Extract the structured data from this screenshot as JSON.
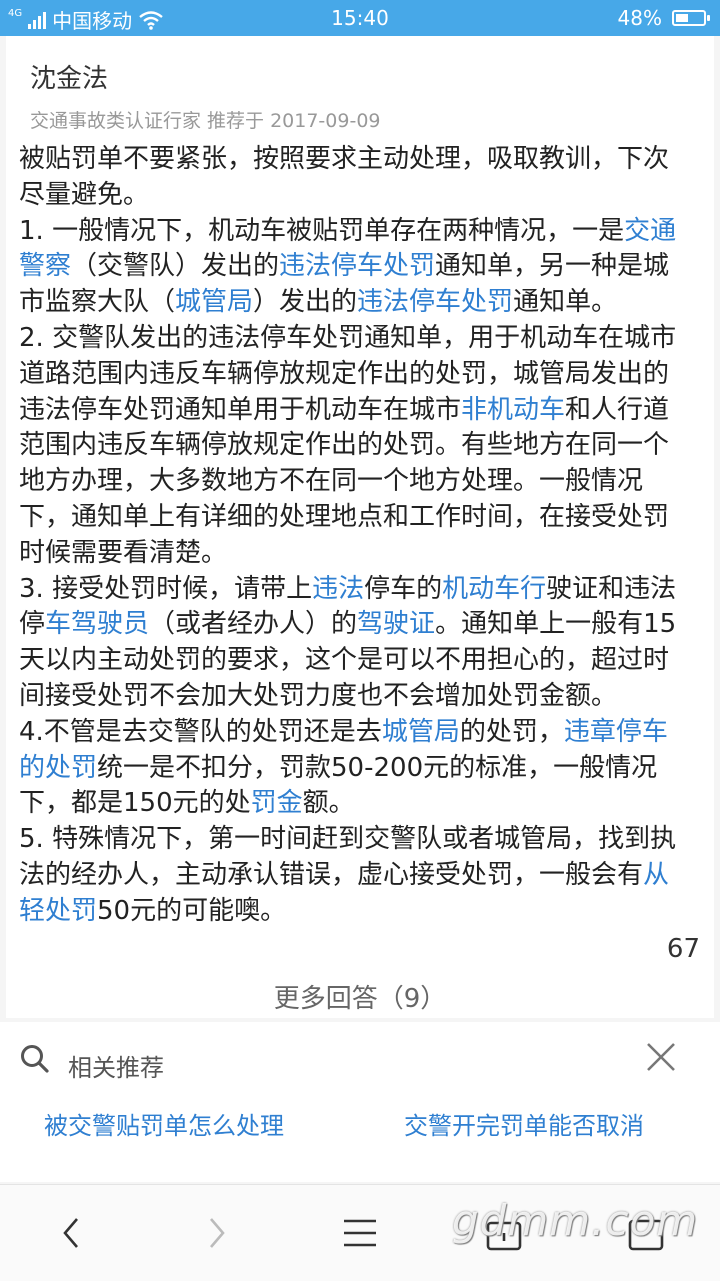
{
  "status": {
    "network_label": "4G",
    "carrier": "中国移动",
    "time": "15:40",
    "battery": "48%",
    "battery_level": 0.48
  },
  "answer": {
    "author": "沈金法",
    "meta": "交通事故类认证行家 推荐于 2017-09-09",
    "likes": "67",
    "paragraphs": [
      [
        {
          "t": "被贴罚单不要紧张，按照要求主动处理，吸取教训，下次尽量避免。",
          "link": false
        }
      ],
      [
        {
          "t": "1. 一般情况下，机动车被贴罚单存在两种情况，一是",
          "link": false
        },
        {
          "t": "交通警察",
          "link": true
        },
        {
          "t": "（交警队）发出的",
          "link": false
        },
        {
          "t": "违法停车处罚",
          "link": true
        },
        {
          "t": "通知单，另一种是城市监察大队（",
          "link": false
        },
        {
          "t": "城管局",
          "link": true
        },
        {
          "t": "）发出的",
          "link": false
        },
        {
          "t": "违法停车处罚",
          "link": true
        },
        {
          "t": "通知单。",
          "link": false
        }
      ],
      [
        {
          "t": "2. 交警队发出的违法停车处罚通知单，用于机动车在城市道路范围内违反车辆停放规定作出的处罚，城管局发出的违法停车处罚通知单用于机动车在城市",
          "link": false
        },
        {
          "t": "非机动车",
          "link": true
        },
        {
          "t": "和人行道范围内违反车辆停放规定作出的处罚。有些地方在同一个地方办理，大多数地方不在同一个地方处理。一般情况下，通知单上有详细的处理地点和工作时间，在接受处罚时候需要看清楚。",
          "link": false
        }
      ],
      [
        {
          "t": "3. 接受处罚时候，请带上",
          "link": false
        },
        {
          "t": "违法",
          "link": true
        },
        {
          "t": "停车的",
          "link": false
        },
        {
          "t": "机动车行",
          "link": true
        },
        {
          "t": "驶证和违法停",
          "link": false
        },
        {
          "t": "车驾驶员",
          "link": true
        },
        {
          "t": "（或者经办人）的",
          "link": false
        },
        {
          "t": "驾驶证",
          "link": true
        },
        {
          "t": "。通知单上一般有15天以内主动处罚的要求，这个是可以不用担心的，超过时间接受处罚不会加大处罚力度也不会增加处罚金额。",
          "link": false
        }
      ],
      [
        {
          "t": "4.不管是去交警队的处罚还是去",
          "link": false
        },
        {
          "t": "城管局",
          "link": true
        },
        {
          "t": "的处罚，",
          "link": false
        },
        {
          "t": "违章停车的处罚",
          "link": true
        },
        {
          "t": "统一是不扣分，罚款50-200元的标准，一般情况下，都是150元的处",
          "link": false
        },
        {
          "t": "罚金",
          "link": true
        },
        {
          "t": "额。",
          "link": false
        }
      ],
      [
        {
          "t": "5. 特殊情况下，第一时间赶到交警队或者城管局，找到执法的经办人，主动承认错误，虚心接受处罚，一般会有",
          "link": false
        },
        {
          "t": "从轻处罚",
          "link": true
        },
        {
          "t": "50元的可能噢。",
          "link": false
        }
      ]
    ],
    "more_answers": "更多回答（9）"
  },
  "related": {
    "title": "相关推荐",
    "items": [
      "被交警贴罚单怎么处理",
      "交警开完罚单能否取消"
    ]
  },
  "watermark": "gdmm.com",
  "icons": {
    "search": "search-icon",
    "close": "close-icon",
    "back": "chevron-left-icon",
    "forward": "chevron-right-icon",
    "menu": "menu-icon",
    "home": "home-icon",
    "tabs": "tabs-icon"
  }
}
